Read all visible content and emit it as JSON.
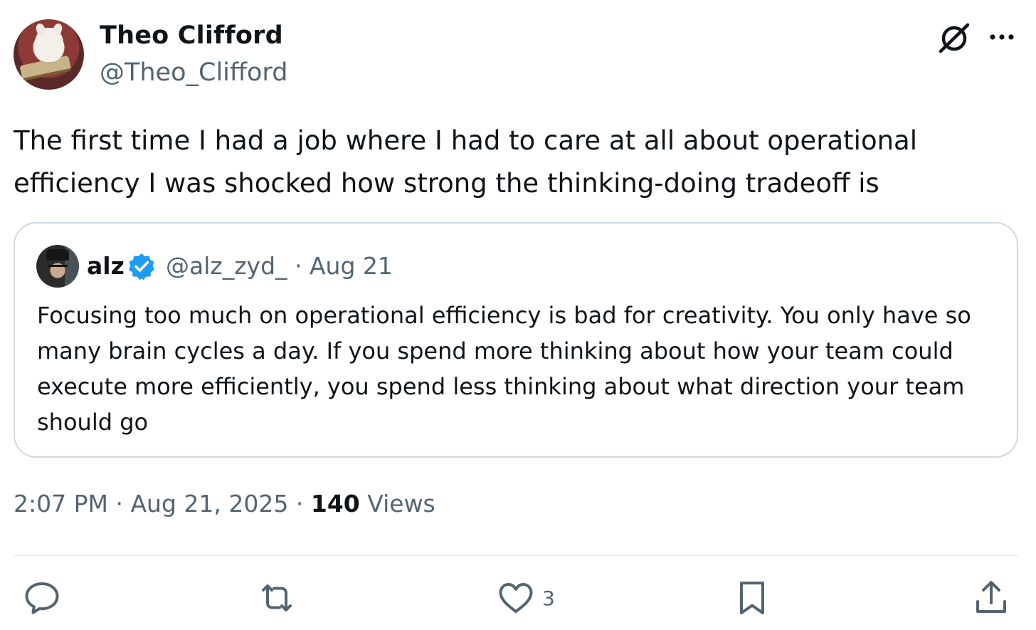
{
  "tweet": {
    "author": {
      "name": "Theo Clifford",
      "handle": "@Theo_Clifford"
    },
    "text": "The first time I had a job where I had to care at all about operational efficiency I was shocked how strong the thinking-doing tradeoff is",
    "time": "2:07 PM",
    "date": "Aug 21, 2025",
    "views_count": "140",
    "views_label": "Views",
    "separator": "·"
  },
  "quote": {
    "name": "alz",
    "handle_date": "@alz_zyd_ · Aug 21",
    "text": "Focusing too much on operational efficiency is bad for creativity. You only have so many brain cycles a day. If you spend more thinking about how your team could execute more efficiently, you spend less thinking about what direction your team should go"
  },
  "actions": {
    "likes": "3"
  },
  "icons": {
    "grok": "grok-icon",
    "more": "more-icon",
    "verified": "verified-badge-icon",
    "reply": "reply-icon",
    "retweet": "retweet-icon",
    "like": "heart-icon",
    "bookmark": "bookmark-icon",
    "share": "share-icon"
  },
  "colors": {
    "text": "#0f1419",
    "secondary": "#536471",
    "border": "#cfd9de",
    "verified": "#1d9bf0"
  }
}
